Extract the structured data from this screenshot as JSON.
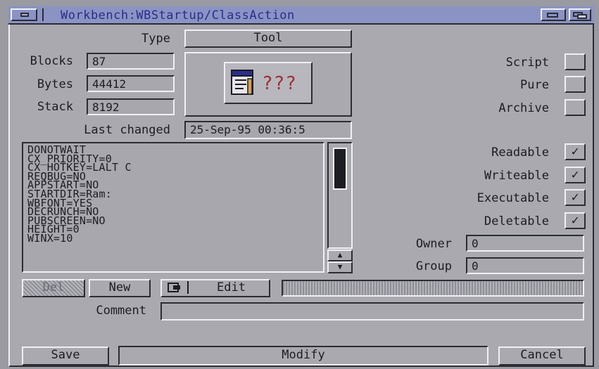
{
  "window": {
    "title": "Workbench:WBStartup/ClassAction"
  },
  "type": {
    "label": "Type",
    "value": "Tool"
  },
  "info": {
    "blocks_label": "Blocks",
    "blocks": "87",
    "bytes_label": "Bytes",
    "bytes": "44412",
    "stack_label": "Stack",
    "stack": "8192",
    "changed_label": "Last changed",
    "changed": "25-Sep-95 00:36:5"
  },
  "icon_preview": {
    "name": "tool-icon",
    "text": "???"
  },
  "tooltypes": [
    "DONOTWAIT",
    "CX_PRIORITY=0",
    "CX_HOTKEY=LALT C",
    "REQBUG=NO",
    "APPSTART=NO",
    "STARTDIR=Ram:",
    "WBFONT=YES",
    "DECRUNCH=NO",
    "PUBSCREEN=NO",
    "HEIGHT=0",
    "WINX=10"
  ],
  "flags": {
    "script": "Script",
    "pure": "Pure",
    "archive": "Archive",
    "readable": "Readable",
    "writeable": "Writeable",
    "executable": "Executable",
    "deletable": "Deletable",
    "check_mark": "✓"
  },
  "owner": {
    "label": "Owner",
    "value": "0"
  },
  "group": {
    "label": "Group",
    "value": "0"
  },
  "buttons": {
    "del": "Del",
    "new": "New",
    "edit": "Edit",
    "save": "Save",
    "modify": "Modify",
    "cancel": "Cancel"
  },
  "comment": {
    "label": "Comment",
    "value": ""
  }
}
